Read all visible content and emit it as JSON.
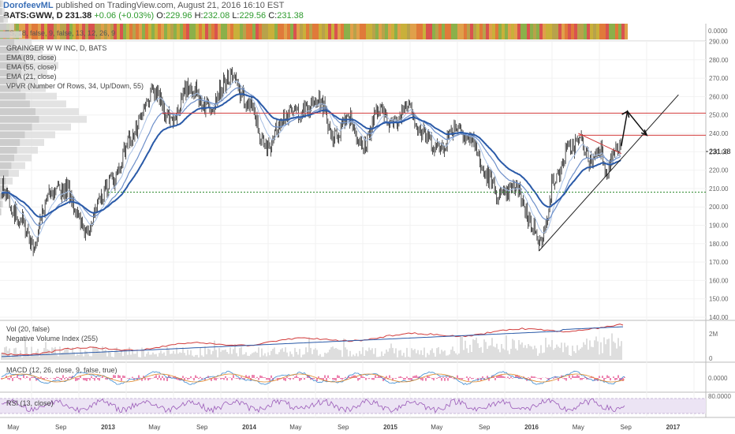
{
  "header": {
    "author": "DorofeevML",
    "published": "published on TradingView.com, August 21, 2016 16:10 EST",
    "symbol": "BATS:GWW, D",
    "price": "231.38",
    "change": "+0.06 (+0.03%)",
    "o_label": "O:",
    "o_value": "229.96",
    "h_label": "H:",
    "h_value": "232.08",
    "l_label": "L:",
    "l_value": "229.56",
    "c_label": "C:",
    "c_value": "231.38"
  },
  "legends": {
    "es": "ES, 18, false, 9, false, 13, 12, 26, 9",
    "company": "GRAINGER W W INC, D, BATS",
    "ema89": "EMA (89, close)",
    "ema55": "EMA (55, close)",
    "ema21": "EMA (21, close)",
    "vpvr": "VPVR (Number Of Rows, 34, Up/Down, 55)",
    "vol": "Vol (20, false)",
    "nvi": "Negative Volume Index (255)",
    "macd": "MACD (12, 26, close, 9, false, true)",
    "rsi": "RSI (13, close)"
  },
  "scales": {
    "es_zero": "0.0000",
    "vol_top": "2M",
    "vol_zero": "0",
    "macd_zero": "0.0000",
    "rsi_top": "80.0000"
  },
  "colors": {
    "price": "#222222",
    "ema89": "#2a5aa8",
    "ema55": "#6d8fc9",
    "ema21": "#a8c0e4",
    "resistance": "#d23c3c",
    "support": "#2e8b2e",
    "trend": "#222222",
    "volume": "#c8c8c8",
    "nvi_red": "#d23c3c",
    "nvi_blue": "#2a5aa8",
    "macd_up": "#e0307a",
    "macd_signal": "#e08a2a",
    "macd_line": "#3a8ad0",
    "rsi": "#9a5ab8",
    "rsi_band": "#ece4f4"
  },
  "chart_data": {
    "type": "line",
    "title": "GRAINGER W W INC, D, BATS",
    "x_ticks": [
      "May",
      "Sep",
      "2013",
      "May",
      "Sep",
      "2014",
      "May",
      "Sep",
      "2015",
      "May",
      "Sep",
      "2016",
      "May",
      "Sep",
      "2017"
    ],
    "y_ticks": [
      140,
      150,
      160,
      170,
      180,
      190,
      200,
      210,
      220,
      230,
      240,
      250,
      260,
      270,
      280,
      290
    ],
    "ylim": [
      140,
      290
    ],
    "last_price_label": "231.38",
    "last_price": 231.38,
    "anchors": [
      {
        "x": "2012-04-01",
        "price": 211
      },
      {
        "x": "2012-05-20",
        "price": 193
      },
      {
        "x": "2012-06-20",
        "price": 180
      },
      {
        "x": "2012-08-01",
        "price": 205
      },
      {
        "x": "2012-09-15",
        "price": 210
      },
      {
        "x": "2012-11-01",
        "price": 188
      },
      {
        "x": "2013-01-15",
        "price": 215
      },
      {
        "x": "2013-03-01",
        "price": 238
      },
      {
        "x": "2013-05-01",
        "price": 262
      },
      {
        "x": "2013-06-15",
        "price": 248
      },
      {
        "x": "2013-08-01",
        "price": 265
      },
      {
        "x": "2013-09-15",
        "price": 255
      },
      {
        "x": "2013-11-15",
        "price": 270
      },
      {
        "x": "2014-01-01",
        "price": 255
      },
      {
        "x": "2014-02-15",
        "price": 232
      },
      {
        "x": "2014-04-01",
        "price": 250
      },
      {
        "x": "2014-05-20",
        "price": 252
      },
      {
        "x": "2014-07-01",
        "price": 258
      },
      {
        "x": "2014-08-10",
        "price": 238
      },
      {
        "x": "2014-09-15",
        "price": 250
      },
      {
        "x": "2014-10-20",
        "price": 232
      },
      {
        "x": "2014-12-01",
        "price": 252
      },
      {
        "x": "2015-01-15",
        "price": 245
      },
      {
        "x": "2015-02-15",
        "price": 258
      },
      {
        "x": "2015-03-20",
        "price": 240
      },
      {
        "x": "2015-05-10",
        "price": 232
      },
      {
        "x": "2015-06-20",
        "price": 244
      },
      {
        "x": "2015-08-01",
        "price": 236
      },
      {
        "x": "2015-09-01",
        "price": 218
      },
      {
        "x": "2015-10-15",
        "price": 205
      },
      {
        "x": "2015-11-20",
        "price": 210
      },
      {
        "x": "2016-01-10",
        "price": 188
      },
      {
        "x": "2016-01-25",
        "price": 180
      },
      {
        "x": "2016-03-01",
        "price": 215
      },
      {
        "x": "2016-04-10",
        "price": 232
      },
      {
        "x": "2016-05-10",
        "price": 236
      },
      {
        "x": "2016-06-01",
        "price": 224
      },
      {
        "x": "2016-06-25",
        "price": 232
      },
      {
        "x": "2016-07-15",
        "price": 220
      },
      {
        "x": "2016-08-05",
        "price": 231
      },
      {
        "x": "2016-08-19",
        "price": 231.38
      }
    ],
    "volume_profile_rows": [
      2,
      4,
      6,
      10,
      16,
      24,
      32,
      40,
      48,
      56,
      70,
      90,
      110,
      100,
      84,
      72,
      58,
      48,
      60,
      74,
      68,
      54,
      40,
      28,
      18,
      10,
      6,
      4
    ],
    "resistance_levels": [
      251,
      239
    ],
    "support_level": 208,
    "uptrend_line": [
      {
        "x": "2016-01-20",
        "price": 176
      },
      {
        "x": "2017-01-15",
        "price": 261
      }
    ],
    "descending_line": [
      {
        "x": "2016-05-01",
        "price": 240
      },
      {
        "x": "2016-08-20",
        "price": 229
      }
    ],
    "projection_path": [
      {
        "x": "2016-08-20",
        "price": 233
      },
      {
        "x": "2016-09-05",
        "price": 252
      },
      {
        "x": "2016-10-25",
        "price": 239
      }
    ]
  }
}
